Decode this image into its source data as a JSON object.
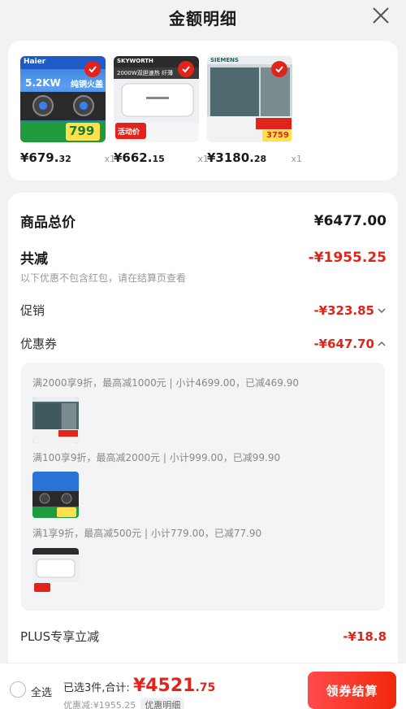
{
  "header": {
    "title": "金额明细"
  },
  "products": [
    {
      "price_main": "¥679.",
      "price_dec": "32",
      "qty": "x1"
    },
    {
      "price_main": "¥662.",
      "price_dec": "15",
      "qty": "x1"
    },
    {
      "price_main": "¥3180.",
      "price_dec": "28",
      "qty": "x1"
    }
  ],
  "thumb_texts": {
    "p1_brand": "Haier",
    "p1_power": "5.2KW",
    "p1_tag": "纯铜火盖",
    "p1_price": "799",
    "p2_brand": "SKYWORTH",
    "p2_line": "2000W双胆速热 纤薄",
    "p2_tag": "活动价",
    "p3_brand": "SIEMENS",
    "p3_price": "3759"
  },
  "summary": {
    "goods_total_label": "商品总价",
    "goods_total_value": "¥6477.00",
    "reduce_label": "共减",
    "reduce_value": "-¥1955.25",
    "note": "以下优惠不包含红包，请在结算页查看",
    "promo_label": "促销",
    "promo_value": "-¥323.85",
    "coupon_label": "优惠券",
    "coupon_value": "-¥647.70",
    "plus_label": "PLUS专享立减",
    "plus_value": "-¥18.8"
  },
  "coupons": [
    {
      "text": "满2000享9折，最高减1000元 | 小计4699.00，已减469.90"
    },
    {
      "text": "满100享9折，最高减2000元 | 小计999.00，已减99.90"
    },
    {
      "text": "满1享9折，最高减500元 | 小计779.00，已减77.90"
    }
  ],
  "bottom": {
    "select_all": "全选",
    "selected_text": "已选3件,合计:",
    "total_main": "¥4521",
    "total_dec": ".75",
    "discount_text": "优惠减:¥1955.25",
    "detail_pill": "优惠明细",
    "checkout": "领券结算"
  },
  "colors": {
    "accent": "#e2231a"
  }
}
